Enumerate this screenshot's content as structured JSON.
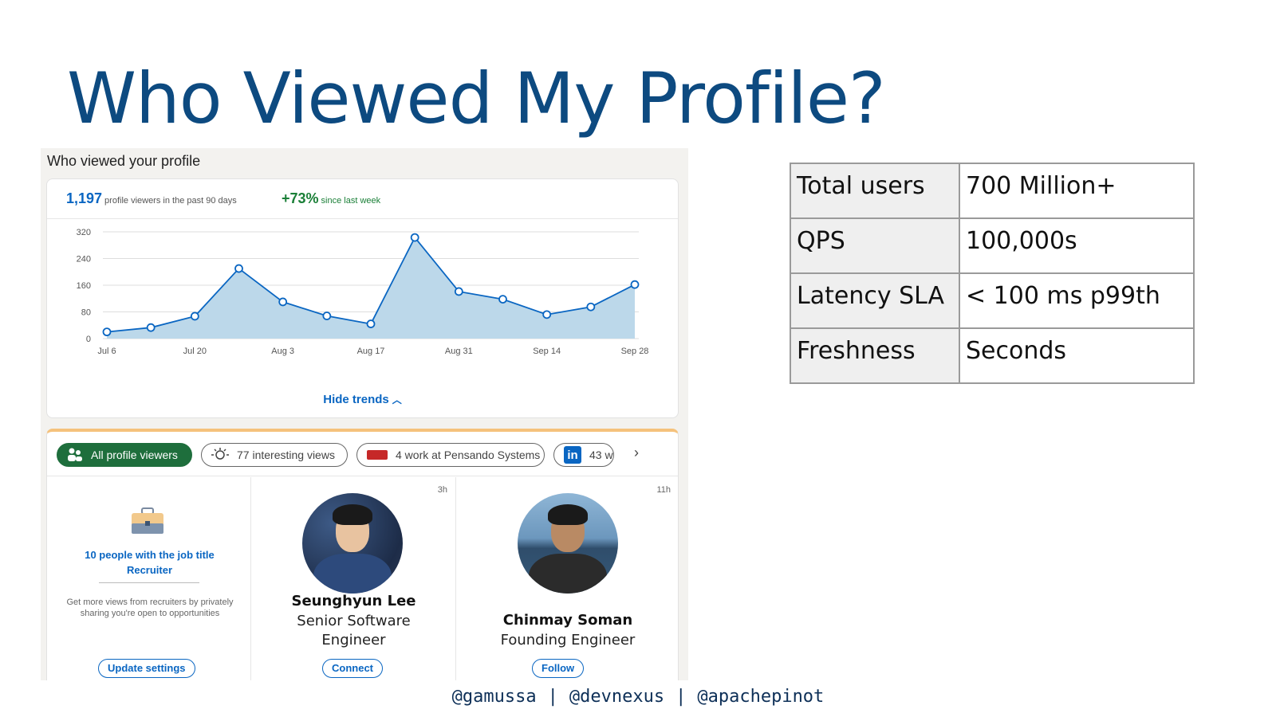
{
  "slide": {
    "title": "Who Viewed My Profile?",
    "footer": {
      "handle_1": "@gamussa",
      "handle_2": "@devnexus",
      "handle_3": "@apachepinot",
      "separator": "|"
    }
  },
  "screenshot": {
    "header": "Who viewed your profile",
    "stats": {
      "viewers_count": "1,197",
      "viewers_label": "profile viewers in the past 90 days",
      "change": "+73%",
      "change_label": "since last week"
    },
    "hide_trends": "Hide trends",
    "filters": [
      {
        "label": "All profile viewers",
        "icon": "people-icon"
      },
      {
        "label": "77 interesting views",
        "icon": "lightbulb-icon"
      },
      {
        "label": "4 work at Pensando Systems",
        "icon": "company-logo"
      },
      {
        "label": "43 w",
        "icon": "linkedin-icon"
      }
    ],
    "viewers": [
      {
        "job_title": "10 people with the job title Recruiter",
        "hint": "Get more views from recruiters by privately sharing you're open to opportunities",
        "button": "Update settings",
        "icon": "briefcase-icon"
      },
      {
        "time": "3h",
        "name": "Seunghyun Lee",
        "role": "Senior Software Engineer",
        "button": "Connect"
      },
      {
        "time": "11h",
        "name": "Chinmay Soman",
        "role": "Founding Engineer",
        "button": "Follow"
      }
    ]
  },
  "facts": [
    {
      "key": "Total users",
      "value": "700 Million+"
    },
    {
      "key": "QPS",
      "value": "100,000s"
    },
    {
      "key": "Latency SLA",
      "value": "< 100 ms p99th"
    },
    {
      "key": "Freshness",
      "value": "Seconds"
    }
  ],
  "colors": {
    "title": "#0d4a80",
    "link": "#0a66c2",
    "positive": "#1a7f37",
    "chart_fill": "#bcd8ea",
    "chart_line": "#0a66c2"
  },
  "chart_data": {
    "type": "area",
    "x_ticks": [
      "Jul 6",
      "Jul 20",
      "Aug 3",
      "Aug 17",
      "Aug 31",
      "Sep 14",
      "Sep 28"
    ],
    "y_ticks": [
      0,
      80,
      160,
      240,
      320
    ],
    "ylim": [
      0,
      320
    ],
    "x": [
      "Jul 6",
      "Jul 13",
      "Jul 20",
      "Jul 27",
      "Aug 3",
      "Aug 10",
      "Aug 17",
      "Aug 24",
      "Aug 31",
      "Sep 7",
      "Sep 14",
      "Sep 21",
      "Sep 28"
    ],
    "values": [
      20,
      33,
      67,
      210,
      110,
      68,
      44,
      303,
      141,
      118,
      72,
      95,
      162
    ],
    "grid": true
  }
}
